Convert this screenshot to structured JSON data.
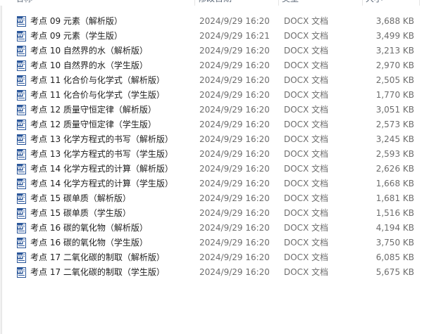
{
  "columns": {
    "name": "名称",
    "date": "修改日期",
    "type": "类型",
    "size": "大小"
  },
  "files": [
    {
      "icon": "word-doc-icon",
      "name": "考点 09 元素（解析版）",
      "date": "2024/9/29 16:20",
      "type": "DOCX 文档",
      "size": "3,688 KB"
    },
    {
      "icon": "word-doc-icon",
      "name": "考点 09 元素（学生版）",
      "date": "2024/9/29 16:21",
      "type": "DOCX 文档",
      "size": "3,499 KB"
    },
    {
      "icon": "word-doc-icon",
      "name": "考点 10 自然界的水（解析版）",
      "date": "2024/9/29 16:20",
      "type": "DOCX 文档",
      "size": "3,213 KB"
    },
    {
      "icon": "word-doc-icon",
      "name": "考点 10 自然界的水（学生版）",
      "date": "2024/9/29 16:20",
      "type": "DOCX 文档",
      "size": "2,970 KB"
    },
    {
      "icon": "word-doc-icon",
      "name": "考点 11 化合价与化学式（解析版）",
      "date": "2024/9/29 16:20",
      "type": "DOCX 文档",
      "size": "2,505 KB"
    },
    {
      "icon": "word-doc-icon",
      "name": "考点 11 化合价与化学式（学生版）",
      "date": "2024/9/29 16:20",
      "type": "DOCX 文档",
      "size": "1,770 KB"
    },
    {
      "icon": "word-doc-icon",
      "name": "考点 12 质量守恒定律（解析版）",
      "date": "2024/9/29 16:20",
      "type": "DOCX 文档",
      "size": "3,051 KB"
    },
    {
      "icon": "word-doc-icon",
      "name": "考点 12 质量守恒定律（学生版）",
      "date": "2024/9/29 16:20",
      "type": "DOCX 文档",
      "size": "2,573 KB"
    },
    {
      "icon": "word-doc-icon",
      "name": "考点 13 化学方程式的书写（解析版）",
      "date": "2024/9/29 16:20",
      "type": "DOCX 文档",
      "size": "3,245 KB"
    },
    {
      "icon": "word-doc-icon",
      "name": "考点 13 化学方程式的书写（学生版）",
      "date": "2024/9/29 16:20",
      "type": "DOCX 文档",
      "size": "2,593 KB"
    },
    {
      "icon": "word-doc-icon",
      "name": "考点 14 化学方程式的计算（解析版）",
      "date": "2024/9/29 16:20",
      "type": "DOCX 文档",
      "size": "2,626 KB"
    },
    {
      "icon": "word-doc-icon",
      "name": "考点 14 化学方程式的计算（学生版）",
      "date": "2024/9/29 16:20",
      "type": "DOCX 文档",
      "size": "1,668 KB"
    },
    {
      "icon": "word-doc-icon",
      "name": "考点 15 碳单质（解析版）",
      "date": "2024/9/29 16:20",
      "type": "DOCX 文档",
      "size": "1,681 KB"
    },
    {
      "icon": "word-doc-icon",
      "name": "考点 15 碳单质（学生版）",
      "date": "2024/9/29 16:20",
      "type": "DOCX 文档",
      "size": "1,516 KB"
    },
    {
      "icon": "word-doc-icon",
      "name": "考点 16 碳的氧化物（解析版）",
      "date": "2024/9/29 16:20",
      "type": "DOCX 文档",
      "size": "4,194 KB"
    },
    {
      "icon": "word-doc-icon",
      "name": "考点 16 碳的氧化物（学生版）",
      "date": "2024/9/29 16:20",
      "type": "DOCX 文档",
      "size": "3,750 KB"
    },
    {
      "icon": "word-doc-icon",
      "name": "考点 17 二氧化碳的制取（解析版）",
      "date": "2024/9/29 16:20",
      "type": "DOCX 文档",
      "size": "6,085 KB"
    },
    {
      "icon": "word-doc-icon",
      "name": "考点 17 二氧化碳的制取（学生版）",
      "date": "2024/9/29 16:20",
      "type": "DOCX 文档",
      "size": "5,675 KB"
    }
  ]
}
